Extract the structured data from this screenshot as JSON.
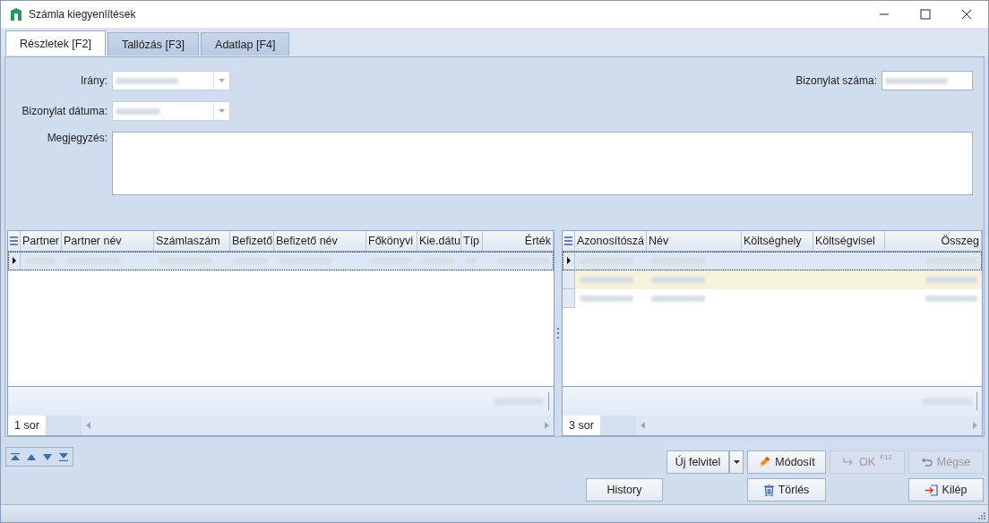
{
  "window": {
    "title": "Számla kiegyenlítések"
  },
  "tabs": [
    {
      "label": "Részletek [F2]",
      "selected": true
    },
    {
      "label": "Tallózás [F3]",
      "selected": false
    },
    {
      "label": "Adatlap [F4]",
      "selected": false
    }
  ],
  "form": {
    "direction_label": "Irány:",
    "date_label": "Bizonylat dátuma:",
    "note_label": "Megjegyzés:",
    "number_label": "Bizonylat száma:"
  },
  "grids": [
    {
      "columns": [
        {
          "label": "Partner"
        },
        {
          "label": "Partner név"
        },
        {
          "label": "Számlaszám"
        },
        {
          "label": "Befizető"
        },
        {
          "label": "Befizető név"
        },
        {
          "label": "Főkönyvi"
        },
        {
          "label": "Kie.dátu"
        },
        {
          "label": "Típ"
        },
        {
          "label": "Érték"
        }
      ],
      "rows": [
        {
          "selected": true,
          "highlighted": false,
          "cells": [
            {
              "kind": "blurred"
            },
            {
              "kind": "blurred"
            },
            {
              "kind": "blurred"
            },
            {
              "kind": "blurred"
            },
            {
              "kind": "blurred"
            },
            {
              "kind": "blurred"
            },
            {
              "kind": "blurred"
            },
            {
              "kind": "blurred"
            },
            {
              "kind": "blurred"
            }
          ]
        }
      ],
      "row_count": "1 sor"
    },
    {
      "columns": [
        {
          "label": "Azonosítószá"
        },
        {
          "label": "Név"
        },
        {
          "label": "Költséghely"
        },
        {
          "label": "Költségvisel"
        },
        {
          "label": "Összeg"
        }
      ],
      "rows": [
        {
          "selected": true,
          "highlighted": false,
          "cells": [
            {
              "kind": "blurred"
            },
            {
              "kind": "blurred"
            },
            {
              "kind": "empty"
            },
            {
              "kind": "empty"
            },
            {
              "kind": "blurred"
            }
          ]
        },
        {
          "selected": false,
          "highlighted": true,
          "cells": [
            {
              "kind": "blurred"
            },
            {
              "kind": "blurred"
            },
            {
              "kind": "empty"
            },
            {
              "kind": "empty"
            },
            {
              "kind": "blurred"
            }
          ]
        },
        {
          "selected": false,
          "highlighted": false,
          "cells": [
            {
              "kind": "blurred"
            },
            {
              "kind": "blurred"
            },
            {
              "kind": "empty"
            },
            {
              "kind": "empty"
            },
            {
              "kind": "blurred"
            }
          ]
        }
      ],
      "row_count": "3 sor"
    }
  ],
  "buttons": [
    {
      "kind": "split",
      "label": "Új felvitel",
      "disabled": false
    },
    {
      "kind": "edit",
      "label": "Módosít",
      "disabled": false
    },
    {
      "kind": "ok",
      "label": "OK",
      "shortcut": "F12",
      "disabled": true
    },
    {
      "kind": "cancel",
      "label": "Mégse",
      "disabled": true
    },
    {
      "kind": "plain",
      "label": "History",
      "disabled": false
    },
    {
      "kind": "delete",
      "label": "Törlés",
      "disabled": false
    },
    {
      "kind": "exit",
      "label": "Kilép",
      "disabled": false
    }
  ]
}
